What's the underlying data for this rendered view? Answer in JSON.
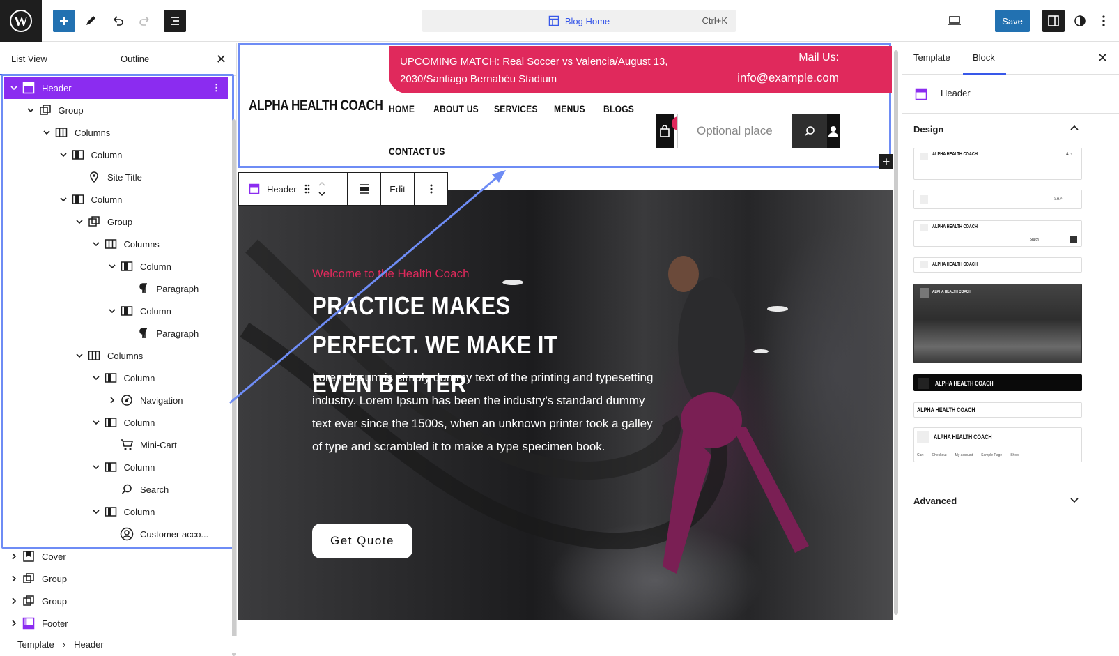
{
  "topbar": {
    "command_title": "Blog Home",
    "command_shortcut": "Ctrl+K",
    "save_label": "Save"
  },
  "left_panel": {
    "tabs": [
      "List View",
      "Outline"
    ],
    "tree": [
      {
        "label": "Header",
        "icon": "template-part-icon",
        "depth": 0,
        "expanded": true,
        "selected": true
      },
      {
        "label": "Group",
        "icon": "group-icon",
        "depth": 1,
        "expanded": true
      },
      {
        "label": "Columns",
        "icon": "columns-icon",
        "depth": 2,
        "expanded": true
      },
      {
        "label": "Column",
        "icon": "column-icon",
        "depth": 3,
        "expanded": true
      },
      {
        "label": "Site Title",
        "icon": "map-pin-icon",
        "depth": 4
      },
      {
        "label": "Column",
        "icon": "column-icon",
        "depth": 3,
        "expanded": true
      },
      {
        "label": "Group",
        "icon": "group-icon",
        "depth": 4,
        "expanded": true
      },
      {
        "label": "Columns",
        "icon": "columns-icon",
        "depth": 5,
        "expanded": true
      },
      {
        "label": "Column",
        "icon": "column-icon",
        "depth": 6,
        "expanded": true
      },
      {
        "label": "Paragraph",
        "icon": "paragraph-icon",
        "depth": 7
      },
      {
        "label": "Column",
        "icon": "column-icon",
        "depth": 6,
        "expanded": true
      },
      {
        "label": "Paragraph",
        "icon": "paragraph-icon",
        "depth": 7
      },
      {
        "label": "Columns",
        "icon": "columns-icon",
        "depth": 4,
        "expanded": true
      },
      {
        "label": "Column",
        "icon": "column-icon",
        "depth": 5,
        "expanded": true
      },
      {
        "label": "Navigation",
        "icon": "navigation-icon",
        "depth": 6,
        "expanded": false
      },
      {
        "label": "Column",
        "icon": "column-icon",
        "depth": 5,
        "expanded": true
      },
      {
        "label": "Mini-Cart",
        "icon": "cart-icon",
        "depth": 6
      },
      {
        "label": "Column",
        "icon": "column-icon",
        "depth": 5,
        "expanded": true
      },
      {
        "label": "Search",
        "icon": "search-icon",
        "depth": 6
      },
      {
        "label": "Column",
        "icon": "column-icon",
        "depth": 5,
        "expanded": true
      },
      {
        "label": "Customer acco...",
        "icon": "user-circle-icon",
        "depth": 6
      },
      {
        "label": "Cover",
        "icon": "cover-icon",
        "depth": 0,
        "expanded": false
      },
      {
        "label": "Group",
        "icon": "group-icon",
        "depth": 0,
        "expanded": false
      },
      {
        "label": "Group",
        "icon": "group-icon",
        "depth": 0,
        "expanded": false
      },
      {
        "label": "Footer",
        "icon": "footer-icon",
        "depth": 0,
        "expanded": false
      }
    ]
  },
  "canvas": {
    "site_title": "ALPHA HEALTH COACH",
    "match_text": "UPCOMING MATCH: Real Soccer vs Valencia/August 13, 2030/Santiago Bernabéu Stadium",
    "mail_label": "Mail Us:",
    "mail_value": "info@example.com",
    "nav": [
      "HOME",
      "ABOUT US",
      "SERVICES",
      "MENUS",
      "BLOGS",
      "CONTACT US"
    ],
    "cart_count": "0",
    "search_placeholder": "Optional place",
    "toolbar": {
      "block_label": "Header",
      "edit_label": "Edit"
    },
    "hero": {
      "welcome": "Welcome to the Health Coach",
      "title": "PRACTICE MAKES PERFECT. WE MAKE IT EVEN BETTER",
      "body": "Lorem Ipsum is simply dummy text of the printing and typesetting industry. Lorem Ipsum has been the industry’s standard dummy text ever since the 1500s, when an unknown printer took a galley of type and scrambled it to make a type specimen book.",
      "button": "Get Quote"
    }
  },
  "right_panel": {
    "tabs": [
      "Template",
      "Block"
    ],
    "block_name": "Header",
    "design_label": "Design",
    "advanced_label": "Advanced",
    "pattern_titles": [
      "ALPHA HEALTH COACH",
      "ALPHA HEALTH COACH",
      "ALPHA HEALTH COACH",
      "ALPHA HEALTH COACH",
      "ALPHA HEALTH COACH",
      "ALPHA HEALTH COACH",
      "ALPHA HEALTH COACH"
    ],
    "pattern_search_word": "Search",
    "pattern_menu_words": [
      "Cart",
      "Checkout",
      "My account",
      "Sample Page",
      "Shop"
    ]
  },
  "breadcrumb": [
    "Template",
    "Header"
  ],
  "colors": {
    "accent": "#3858e9",
    "wp_blue": "#2271b1",
    "brand_pink": "#e0295c",
    "selection_purple": "#8b2cf0"
  }
}
